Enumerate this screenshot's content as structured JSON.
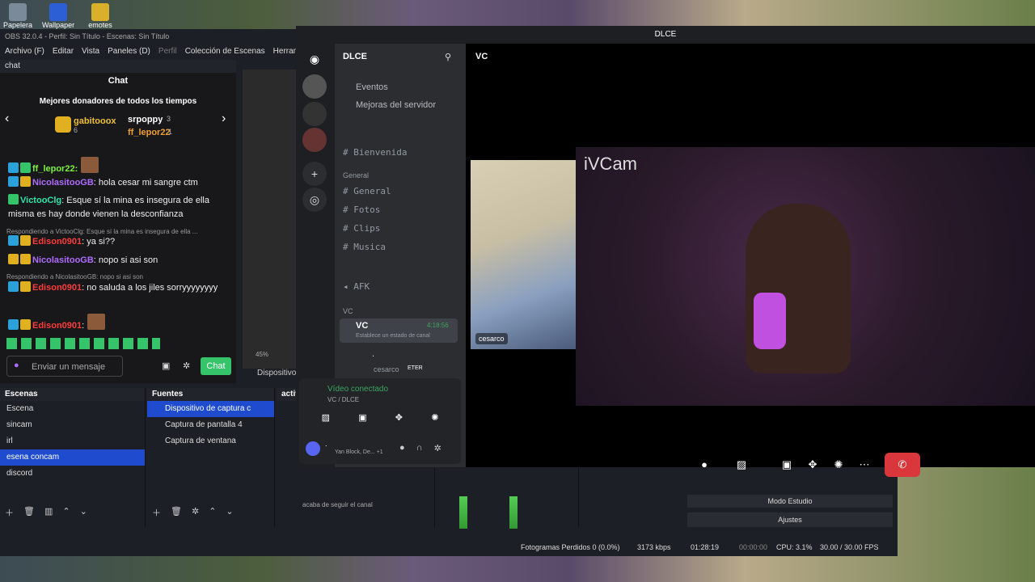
{
  "desktop": {
    "icons": [
      "Papelera de",
      "Wallpaper",
      "emotes"
    ]
  },
  "obs": {
    "title": "OBS 32.0.4 - Perfil: Sin Título - Escenas: Sin Título",
    "menu": [
      "Archivo (F)",
      "Editar",
      "Vista",
      "Paneles (D)",
      "Perfil",
      "Colección de Escenas",
      "Herramientas"
    ],
    "chat_dock_label": "chat",
    "chat_title": "Chat",
    "donors_title": "Mejores donadores de todos los tiempos",
    "donors": [
      {
        "name": "gabitooox",
        "count": "6"
      },
      {
        "name": "srpoppy",
        "count": "3"
      },
      {
        "name": "ff_lepor22",
        "count": "1"
      }
    ],
    "messages": [
      {
        "user": "ff_lepor22:",
        "text": "",
        "color": "#7cf23a"
      },
      {
        "user": "NicolasitooGB",
        "text": ": hola cesar mi sangre ctm",
        "color": "#b06cff"
      },
      {
        "user": "VictooClg",
        "text": ": Esque sí la mina es insegura de ella misma es hay donde vienen la desconfianza",
        "color": "#2ce6a8"
      },
      {
        "user": "Edison0901",
        "text": ": ya si??",
        "color": "#ff3c3c",
        "reply": "Respondiendo a VictooClg: Esque sí la mina es insegura de ella ..."
      },
      {
        "user": "NicolasitooGB",
        "text": ": nopo si asi son",
        "color": "#b06cff"
      },
      {
        "user": "Edison0901",
        "text": ": no saluda a los jiles sorryyyyyyyy",
        "color": "#ff3c3c",
        "reply": "Respondiendo a NicolasitooGB: nopo si asi son"
      },
      {
        "user": "Edison0901",
        "text": ":",
        "color": "#ff3c3c"
      }
    ],
    "chat_input_placeholder": "Enviar un mensaje",
    "chat_button": "Chat",
    "preview_zoom": "45%",
    "preview_source": "Dispositivo",
    "scenes_label": "Escenas",
    "scenes": [
      "Escena",
      "sincam",
      "irl",
      "esena concam",
      "discord"
    ],
    "selected_scene": "esena concam",
    "sources_label": "Fuentes",
    "sources": [
      "Dispositivo de captura c",
      "Captura de pantalla 4",
      "Captura de ventana"
    ],
    "activity_label": "activ",
    "activity_text": "acaba de seguir el canal",
    "studio_mode": "Modo Estudio",
    "settings": "Ajustes",
    "status": {
      "dropped": "Fotogramas Perdidos 0 (0.0%)",
      "bitrate": "3173 kbps",
      "stream_time": "01:28:19",
      "rec_time": "00:00:00",
      "cpu": "CPU: 3.1%",
      "fps": "30.00 / 30.00 FPS"
    }
  },
  "discord": {
    "window_title": "DLCE",
    "server_name": "DLCE",
    "menu_items": [
      "Eventos",
      "Mejoras del servidor"
    ],
    "top_channels": [
      "Bienvenida"
    ],
    "category_general": "General",
    "general_channels": [
      "General",
      "Fotos",
      "Clips",
      "Musica"
    ],
    "afk": "AFK",
    "category_vc": "VC",
    "vc_channel": "VC",
    "vc_timer": "4:18:56",
    "vc_status": "Establece un estado de canal",
    "vc_members": [
      ".",
      "cesarco"
    ],
    "vc_member_tag": "ETER",
    "voice_connected": "Vídeo conectado",
    "voice_sub": "VC / DLCE",
    "user_name": ".",
    "user_activity": "Yan Block, De... +1",
    "header_channel": "VC",
    "tile_small_name": "cesarco",
    "tile_large_label": "iVCam",
    "accent": "#5865f2"
  }
}
